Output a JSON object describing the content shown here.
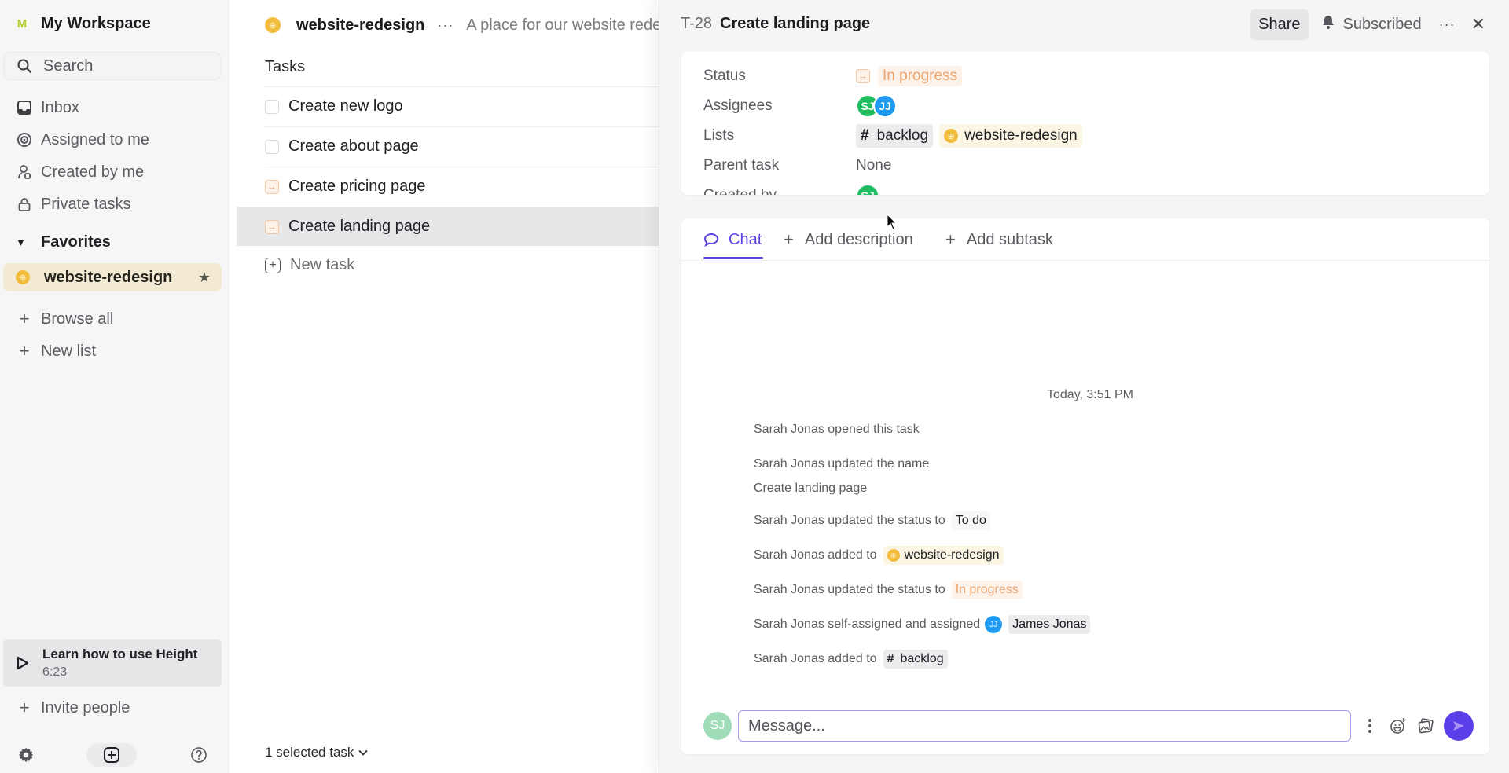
{
  "sidebar": {
    "workspace_initial": "M",
    "workspace_name": "My Workspace",
    "search_label": "Search",
    "nav": [
      {
        "label": "Inbox",
        "icon": "inbox-icon"
      },
      {
        "label": "Assigned to me",
        "icon": "target-icon"
      },
      {
        "label": "Created by me",
        "icon": "user-created-icon"
      },
      {
        "label": "Private tasks",
        "icon": "lock-icon"
      }
    ],
    "favorites_label": "Favorites",
    "favorite_item": "website-redesign",
    "browse_all": "Browse all",
    "new_list": "New list",
    "learn_title": "Learn how to use Height",
    "learn_duration": "6:23",
    "invite": "Invite people"
  },
  "list": {
    "name": "website-redesign",
    "description": "A place for our website redes",
    "tasks_header": "Tasks",
    "tasks": [
      {
        "title": "Create new logo",
        "status": "todo"
      },
      {
        "title": "Create about page",
        "status": "todo"
      },
      {
        "title": "Create pricing page",
        "status": "in-progress"
      },
      {
        "title": "Create landing page",
        "status": "in-progress",
        "selected": true
      }
    ],
    "new_task": "New task",
    "selection_summary": "1 selected task"
  },
  "detail": {
    "task_id": "T-28",
    "title": "Create landing page",
    "share_label": "Share",
    "subscribed_label": "Subscribed",
    "props": {
      "status_label": "Status",
      "status_value": "In progress",
      "assignees_label": "Assignees",
      "assignees": [
        "SJ",
        "JJ"
      ],
      "lists_label": "Lists",
      "lists": [
        "backlog",
        "website-redesign"
      ],
      "parent_label": "Parent task",
      "parent_value": "None",
      "created_by_label": "Created by",
      "created_by": "SJ"
    },
    "tabs": {
      "chat": "Chat",
      "add_description": "Add description",
      "add_subtask": "Add subtask"
    },
    "timestamp": "Today, 3:51 PM",
    "events": {
      "e1": "Sarah Jonas opened this task",
      "e2": "Sarah Jonas updated the name",
      "e2_value": "Create landing page",
      "e3": "Sarah Jonas updated the status to",
      "e3_value": "To do",
      "e4": "Sarah Jonas added to",
      "e4_value": "website-redesign",
      "e5": "Sarah Jonas updated the status to",
      "e5_value": "In progress",
      "e6": "Sarah Jonas self-assigned and assigned",
      "e6_avatar": "JJ",
      "e6_value": "James Jonas",
      "e7": "Sarah Jonas added to",
      "e7_value": "backlog"
    },
    "composer": {
      "avatar": "SJ",
      "placeholder": "Message..."
    }
  },
  "colors": {
    "accent": "#5b45e0",
    "in_progress": "#eda36e",
    "favorite_bg": "#f2ead2",
    "avatar_sj": "#1fbd5f",
    "avatar_jj": "#1e9bf0"
  }
}
